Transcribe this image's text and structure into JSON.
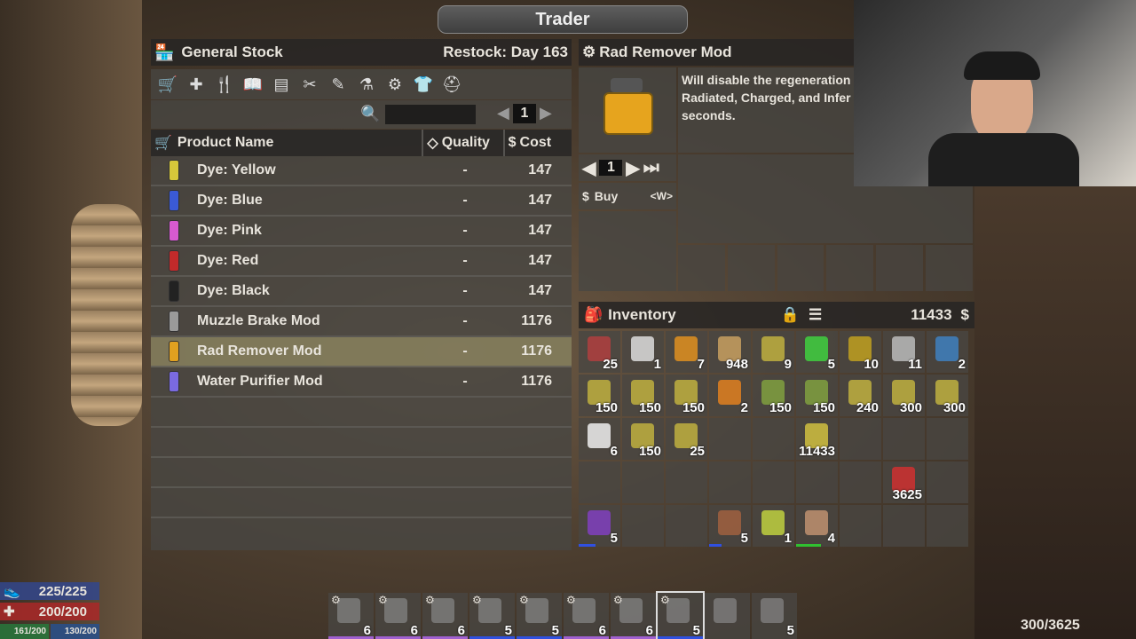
{
  "window_title": "Trader",
  "stock": {
    "title": "General Stock",
    "restock": "Restock: Day 163",
    "categories": [
      "cart-icon",
      "medical-icon",
      "food-icon",
      "book-icon",
      "building-icon",
      "tools-icon",
      "weapons-icon",
      "chemistry-icon",
      "parts-icon",
      "clothing-icon",
      "armor-icon"
    ],
    "page": "1",
    "columns": {
      "name": "Product Name",
      "quality": "Quality",
      "cost": "Cost"
    },
    "items": [
      {
        "name": "Dye: Yellow",
        "quality": "-",
        "cost": "147",
        "color": "#d6c73a"
      },
      {
        "name": "Dye: Blue",
        "quality": "-",
        "cost": "147",
        "color": "#3a5ad6"
      },
      {
        "name": "Dye: Pink",
        "quality": "-",
        "cost": "147",
        "color": "#d65ad0"
      },
      {
        "name": "Dye: Red",
        "quality": "-",
        "cost": "147",
        "color": "#c22a2a"
      },
      {
        "name": "Dye: Black",
        "quality": "-",
        "cost": "147",
        "color": "#222222"
      },
      {
        "name": "Muzzle Brake Mod",
        "quality": "-",
        "cost": "1176",
        "color": "#9a9a9a"
      },
      {
        "name": "Rad Remover Mod",
        "quality": "-",
        "cost": "1176",
        "color": "#e0a020"
      },
      {
        "name": "Water Purifier Mod",
        "quality": "-",
        "cost": "1176",
        "color": "#7a6ae0"
      }
    ]
  },
  "detail": {
    "title": "Rad Remover Mod",
    "description": "Will disable the regeneration\nRadiated, Charged, and Infer\nseconds.",
    "quantity": "1",
    "buy_label": "Buy",
    "buy_key": "<W>"
  },
  "inventory": {
    "title": "Inventory",
    "money": "11433",
    "cells": [
      {
        "count": "25",
        "color": "#b04040"
      },
      {
        "count": "1",
        "color": "#ddd"
      },
      {
        "count": "7",
        "color": "#e09020"
      },
      {
        "count": "948",
        "color": "#c8a060"
      },
      {
        "count": "9",
        "color": "#c0b040"
      },
      {
        "count": "5",
        "color": "#40d040"
      },
      {
        "count": "10",
        "color": "#c0a020"
      },
      {
        "count": "11",
        "color": "#bbb"
      },
      {
        "count": "2",
        "color": "#4080c0"
      },
      {
        "count": "150",
        "color": "#c0b040"
      },
      {
        "count": "150",
        "color": "#c0b040"
      },
      {
        "count": "150",
        "color": "#c0b040"
      },
      {
        "count": "2",
        "color": "#e08020"
      },
      {
        "count": "150",
        "color": "#80a040"
      },
      {
        "count": "150",
        "color": "#80a040"
      },
      {
        "count": "240",
        "color": "#c0b040"
      },
      {
        "count": "300",
        "color": "#c0b040"
      },
      {
        "count": "300",
        "color": "#c0b040"
      },
      {
        "count": "6",
        "color": "#eee"
      },
      {
        "count": "150",
        "color": "#c0b040"
      },
      {
        "count": "25",
        "color": "#c0b040"
      },
      {
        "count": "",
        "color": ""
      },
      {
        "count": "",
        "color": ""
      },
      {
        "count": "11433",
        "color": "#d0c040"
      },
      {
        "count": "",
        "color": ""
      },
      {
        "count": "",
        "color": ""
      },
      {
        "count": "",
        "color": ""
      },
      {
        "count": "",
        "color": ""
      },
      {
        "count": "",
        "color": ""
      },
      {
        "count": "",
        "color": ""
      },
      {
        "count": "",
        "color": ""
      },
      {
        "count": "",
        "color": ""
      },
      {
        "count": "",
        "color": ""
      },
      {
        "count": "",
        "color": ""
      },
      {
        "count": "3625",
        "color": "#d03030"
      },
      {
        "count": "",
        "color": ""
      },
      {
        "count": "5",
        "color": "#8040c0"
      },
      {
        "count": "",
        "color": ""
      },
      {
        "count": "",
        "color": ""
      },
      {
        "count": "5",
        "color": "#a06040"
      },
      {
        "count": "1",
        "color": "#c0d040"
      },
      {
        "count": "4",
        "color": "#c09070"
      },
      {
        "count": "",
        "color": ""
      },
      {
        "count": "",
        "color": ""
      },
      {
        "count": "",
        "color": ""
      }
    ]
  },
  "toolbelt": [
    {
      "count": "6"
    },
    {
      "count": "6"
    },
    {
      "count": "6"
    },
    {
      "count": "5"
    },
    {
      "count": "5"
    },
    {
      "count": "6"
    },
    {
      "count": "6"
    },
    {
      "count": "5"
    },
    {
      "count": ""
    },
    {
      "count": "5"
    }
  ],
  "stats": {
    "stamina": "225/225",
    "health": "200/200",
    "food": "161/200",
    "water": "130/200",
    "carry": "300/3625"
  }
}
